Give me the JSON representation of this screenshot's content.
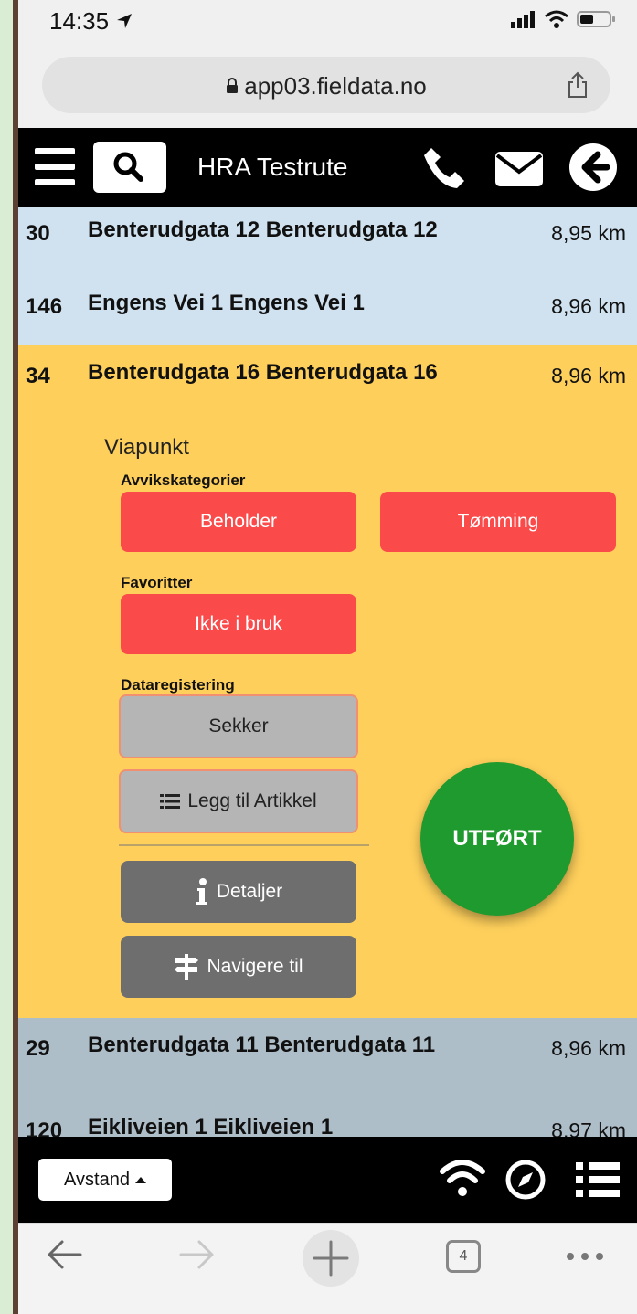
{
  "status_bar": {
    "time": "14:35"
  },
  "browser": {
    "url": "app03.fieldata.no",
    "tabs_count": "4"
  },
  "header": {
    "title": "HRA Testrute"
  },
  "rows": [
    {
      "number": "30",
      "title": "Benterudgata 12 Benterudgata 12",
      "distance": "8,95 km"
    },
    {
      "number": "146",
      "title": "Engens Vei 1 Engens Vei 1",
      "distance": "8,96 km"
    },
    {
      "number": "34",
      "title": "Benterudgata 16 Benterudgata 16",
      "distance": "8,96 km"
    },
    {
      "number": "29",
      "title": "Benterudgata 11 Benterudgata 11",
      "distance": "8,96 km"
    },
    {
      "number": "120",
      "title": "Eikliveien 1 Eikliveien 1",
      "distance": "8,97 km"
    }
  ],
  "selected": {
    "subtitle": "Viapunkt",
    "sections": {
      "deviation": "Avvikskategorier",
      "favorites": "Favoritter",
      "data_registration": "Dataregistering"
    },
    "buttons": {
      "beholder": "Beholder",
      "tomming": "Tømming",
      "ikke_i_bruk": "Ikke i bruk",
      "sekker": "Sekker",
      "legg_til": "Legg til Artikkel",
      "detaljer": "Detaljer",
      "navigere": "Navigere til"
    },
    "done": "UTFØRT"
  },
  "bottom": {
    "sort_label": "Avstand"
  },
  "colors": {
    "selected_row": "#fecf5b",
    "row_blue": "#d0e2f0",
    "row_gray": "#aebec9",
    "red_button": "#fb4a4a",
    "done_button": "#1f9a2e"
  }
}
